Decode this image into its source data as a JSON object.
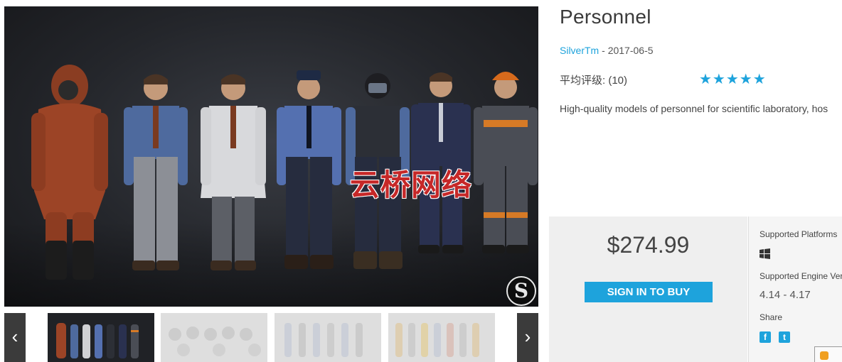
{
  "product": {
    "title": "Personnel",
    "author": "SilverTm",
    "date_separator": " - ",
    "date": "2017-06-5",
    "rating_label": "平均评级: (10)",
    "stars": "★★★★★",
    "rating_stars": 5,
    "description": "High-quality models of personnel for scientific laboratory, hos"
  },
  "hero": {
    "watermark": "云桥网络",
    "logo_letter": "S"
  },
  "gallery": {
    "prev_label": "‹",
    "next_label": "›",
    "prev_icon": "chevron-left-icon",
    "next_icon": "chevron-right-icon"
  },
  "purchase": {
    "price": "$274.99",
    "buy_label": "SIGN IN TO BUY"
  },
  "info": {
    "platforms_label": "Supported Platforms",
    "platform_icon": "windows-icon",
    "engine_label": "Supported Engine Versions",
    "engine_value": "4.14 - 4.17",
    "share_label": "Share",
    "facebook_glyph": "f",
    "twitter_glyph": "t"
  },
  "colors": {
    "accent": "#1ea3dc",
    "watermark": "#c62828",
    "panel_bg": "#efefef"
  }
}
